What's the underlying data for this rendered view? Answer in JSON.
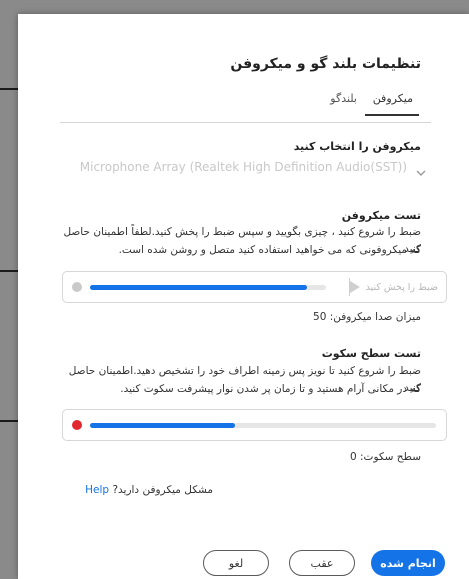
{
  "dialog": {
    "title": "تنظیمات بلند گو و میکروفن",
    "tabs": [
      {
        "label": "میکروفن",
        "active": true
      },
      {
        "label": "بلندگو",
        "active": false
      }
    ]
  },
  "mic_select": {
    "heading": "میکروفن را انتخاب کنید",
    "selected_device": "Microphone Array (Realtek High Definition Audio(SST))"
  },
  "mic_test": {
    "heading": "تست میکروفن",
    "line1": "ضبط را شروع کنید ، چیزی بگویید و سپس ضبط را پخش کنید.لطفاً اطمینان حاصل کنید",
    "line2": "که میکروفونی که می خواهید استفاده کنید متصل و روشن شده است.",
    "play_label": "ضبط را پخش کنید",
    "level_label": "میزان صدا میکروفن:",
    "level_value": "50",
    "progress": 0.92
  },
  "silence_test": {
    "heading": "تست سطح سکوت",
    "line1": "ضبط را شروع کنید تا نویز پس زمینه اطراف خود را تشخیص دهید.اطمینان حاصل کنید",
    "line2": "که در مکانی آرام هستید و تا زمان پر شدن نوار پیشرفت سکوت کنید.",
    "level_label": "سطح سکوت:",
    "level_value": "0",
    "progress": 0.42
  },
  "help": {
    "question": "مشکل میکروفن دارید?",
    "link": "Help"
  },
  "buttons": {
    "done": "انجام شده",
    "back": "عقب",
    "cancel": "لغو"
  },
  "colors": {
    "accent": "#1473e6",
    "record_dot": "#e0282e",
    "idle_dot": "#c9c9c9"
  }
}
